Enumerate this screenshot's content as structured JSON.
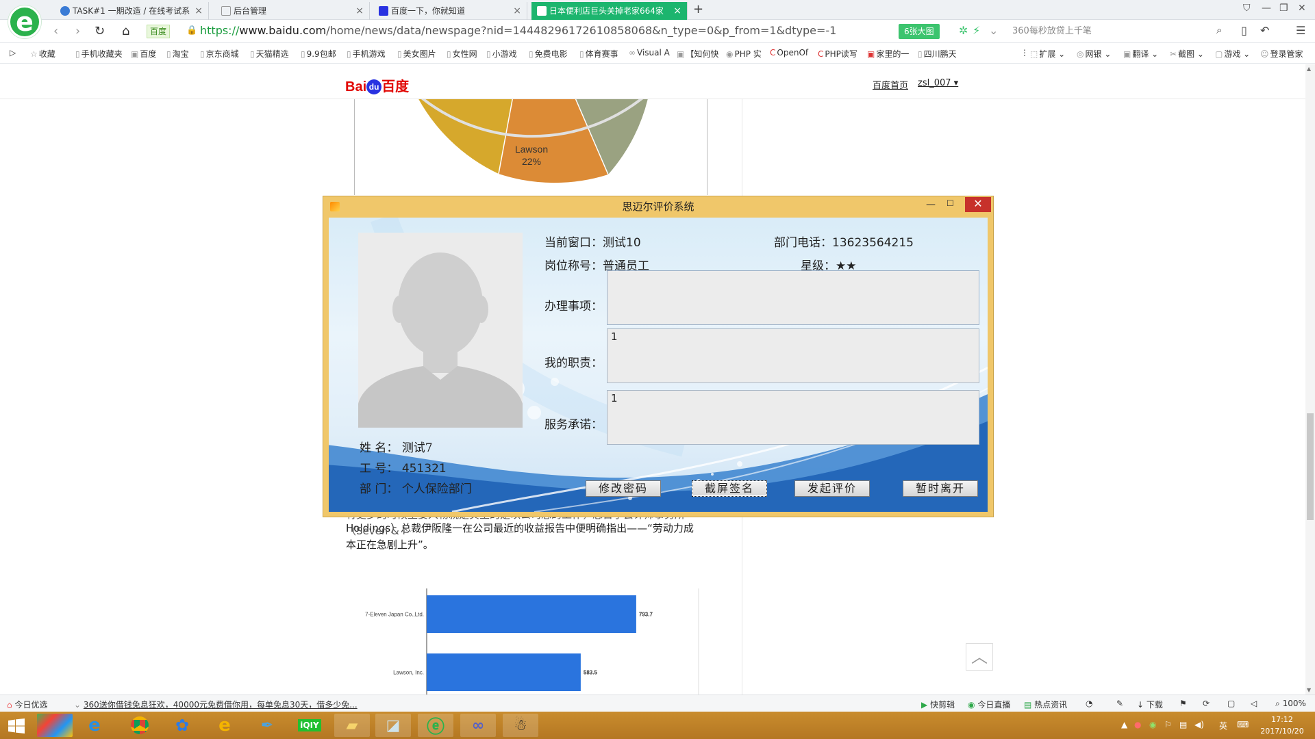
{
  "browser": {
    "tabs": [
      {
        "label": "TASK#1 一期改造 / 在线考试系",
        "active": false,
        "icon_color": "#3a7bd5"
      },
      {
        "label": "后台管理",
        "active": false,
        "icon_color": "#9aa0a6"
      },
      {
        "label": "百度一下，你就知道",
        "active": false,
        "icon_color": "#2932e1"
      },
      {
        "label": "日本便利店巨头关掉老家664家",
        "active": true,
        "icon_color": "#2932e1"
      }
    ],
    "new_tab": "+",
    "address": {
      "chip": "百度",
      "protocol": "https://",
      "domain": "www.baidu.com",
      "path": "/home/news/data/newspage?nid=14448296172610858068&n_type=0&p_from=1&dtype=-1"
    },
    "big_image_button": "6张大图",
    "search_placeholder": "360每秒放贷上千笔",
    "bookmarks": [
      "收藏",
      "手机收藏夹",
      "百度",
      "淘宝",
      "京东商城",
      "天猫精选",
      "9.9包邮",
      "手机游戏",
      "美女图片",
      "女性网",
      "小游戏",
      "免费电影",
      "体育赛事",
      "Visual A",
      "【知何快",
      "PHP 实",
      "OpenOf",
      "PHP读写",
      "家里的一",
      "四川鹏天"
    ],
    "bookmarks_right": [
      "扩展",
      "网银",
      "翻译",
      "截图",
      "游戏",
      "登录管家"
    ]
  },
  "page": {
    "logo_text": "Bai",
    "logo_paw": "du",
    "logo_cn": "百度",
    "nav_home": "百度首页",
    "nav_user": "zsl_007",
    "pie_label": "Lawson",
    "pie_value": "22%",
    "article_partial": "有更多的时候主要人物就是其主的是以公司总的工作，总日子会计师事务所（Seven & i",
    "article_lines": [
      "Holdings）总裁伊阪隆一在公司最近的收益报告中便明确指出——“劳动力成",
      "本正在急剧上升”。"
    ],
    "scroll_top": "︿"
  },
  "chart_data": {
    "type": "bar",
    "orientation": "horizontal",
    "categories": [
      "7-Eleven Japan Co.,Ltd.",
      "Lawson, Inc."
    ],
    "values": [
      793.7,
      583.5
    ],
    "value_labels": [
      "793.7",
      "583.5"
    ],
    "xlim": [
      0,
      960
    ],
    "bar_color": "#2a74de"
  },
  "dialog": {
    "title": "思迈尔评价系统",
    "current_window_label": "当前窗口：",
    "current_window_value": "测试10",
    "dept_phone_label": "部门电话：",
    "dept_phone_value": "13623564215",
    "position_label": "岗位称号：",
    "position_value": "普通员工",
    "star_label": "星级：",
    "star_value": "★★",
    "items": [
      {
        "label": "办理事项：",
        "value": ""
      },
      {
        "label": "我的职责：",
        "value": "1"
      },
      {
        "label": "服务承诺：",
        "value": "1"
      }
    ],
    "name_label": "姓 名：",
    "name_value": "测试7",
    "id_label": "工 号：",
    "id_value": "451321",
    "dept_label": "部 门：",
    "dept_value": "个人保险部门",
    "buttons": [
      "修改密码",
      "截屏签名",
      "发起评价",
      "暂时离开"
    ]
  },
  "statusbar": {
    "left_label": "今日优选",
    "news": "360送你借钱免息狂欢，40000元免费借你用，每单免息30天，借多少免...",
    "right": [
      "快剪辑",
      "今日直播",
      "热点资讯",
      "下载"
    ],
    "zoom": "100%"
  },
  "taskbar": {
    "apps": [
      "ie",
      "folder",
      "chrome",
      "baidu",
      "ie2",
      "pen",
      "iqiyi",
      "files",
      "notes",
      "360",
      "glasses",
      "qq"
    ],
    "tray_lang": "英",
    "time": "17:12",
    "date": "2017/10/20"
  },
  "colors": {
    "accent_green": "#1cb56e",
    "dialog_frame": "#f0c76a",
    "close_red": "#c7312b",
    "taskbar": "#c98c2e"
  }
}
